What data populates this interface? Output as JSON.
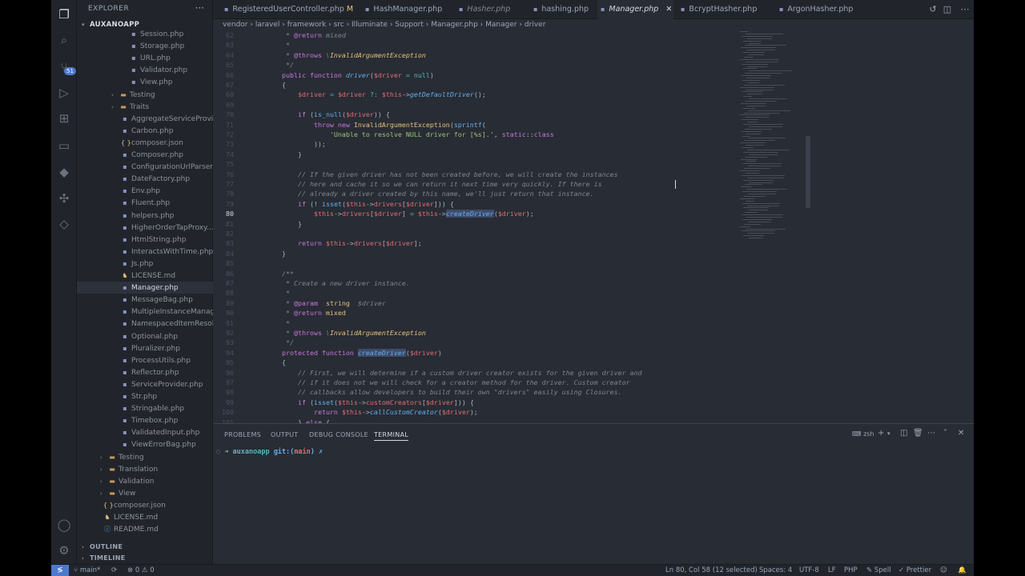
{
  "sidebar": {
    "title": "EXPLORER",
    "more": "···",
    "project": "AUXANOAPP",
    "items": [
      {
        "label": "Session.php",
        "icon": "php",
        "indent": 2
      },
      {
        "label": "Storage.php",
        "icon": "php",
        "indent": 2
      },
      {
        "label": "URL.php",
        "icon": "php",
        "indent": 2
      },
      {
        "label": "Validator.php",
        "icon": "php",
        "indent": 2
      },
      {
        "label": "View.php",
        "icon": "php",
        "indent": 2
      },
      {
        "label": "Testing",
        "icon": "folder",
        "indent": 1
      },
      {
        "label": "Traits",
        "icon": "folder",
        "indent": 1
      },
      {
        "label": "AggregateServiceProvi...",
        "icon": "php",
        "indent": 1
      },
      {
        "label": "Carbon.php",
        "icon": "php",
        "indent": 1
      },
      {
        "label": "composer.json",
        "icon": "json",
        "indent": 1
      },
      {
        "label": "Composer.php",
        "icon": "php",
        "indent": 1
      },
      {
        "label": "ConfigurationUrlParser...",
        "icon": "php",
        "indent": 1
      },
      {
        "label": "DateFactory.php",
        "icon": "php",
        "indent": 1
      },
      {
        "label": "Env.php",
        "icon": "php",
        "indent": 1
      },
      {
        "label": "Fluent.php",
        "icon": "php",
        "indent": 1
      },
      {
        "label": "helpers.php",
        "icon": "php",
        "indent": 1
      },
      {
        "label": "HigherOrderTapProxy....",
        "icon": "php",
        "indent": 1
      },
      {
        "label": "HtmlString.php",
        "icon": "php",
        "indent": 1
      },
      {
        "label": "InteractsWithTime.php",
        "icon": "php",
        "indent": 1
      },
      {
        "label": "Js.php",
        "icon": "php",
        "indent": 1
      },
      {
        "label": "LICENSE.md",
        "icon": "lic",
        "indent": 1
      },
      {
        "label": "Manager.php",
        "icon": "php",
        "indent": 1,
        "selected": true
      },
      {
        "label": "MessageBag.php",
        "icon": "php",
        "indent": 1
      },
      {
        "label": "MultipleInstanceManag...",
        "icon": "php",
        "indent": 1
      },
      {
        "label": "NamespacedItemResol...",
        "icon": "php",
        "indent": 1
      },
      {
        "label": "Optional.php",
        "icon": "php",
        "indent": 1
      },
      {
        "label": "Pluralizer.php",
        "icon": "php",
        "indent": 1
      },
      {
        "label": "ProcessUtils.php",
        "icon": "php",
        "indent": 1
      },
      {
        "label": "Reflector.php",
        "icon": "php",
        "indent": 1
      },
      {
        "label": "ServiceProvider.php",
        "icon": "php",
        "indent": 1
      },
      {
        "label": "Str.php",
        "icon": "php",
        "indent": 1
      },
      {
        "label": "Stringable.php",
        "icon": "php",
        "indent": 1
      },
      {
        "label": "Timebox.php",
        "icon": "php",
        "indent": 1
      },
      {
        "label": "ValidatedInput.php",
        "icon": "php",
        "indent": 1
      },
      {
        "label": "ViewErrorBag.php",
        "icon": "php",
        "indent": 1
      },
      {
        "label": "Testing",
        "icon": "folder",
        "indent": 0
      },
      {
        "label": "Translation",
        "icon": "folder",
        "indent": 0
      },
      {
        "label": "Validation",
        "icon": "folder",
        "indent": 0
      },
      {
        "label": "View",
        "icon": "folder",
        "indent": 0
      },
      {
        "label": "composer.json",
        "icon": "json",
        "indent": -1
      },
      {
        "label": "LICENSE.md",
        "icon": "lic",
        "indent": -1
      },
      {
        "label": "README.md",
        "icon": "md",
        "indent": -1
      }
    ],
    "outline": "OUTLINE",
    "timeline": "TIMELINE"
  },
  "activity": {
    "scm_badge": "51"
  },
  "tabs": [
    {
      "label": "RegisteredUserController.php",
      "suffix": "M",
      "italic": false
    },
    {
      "label": "HashManager.php",
      "italic": false
    },
    {
      "label": "Hasher.php",
      "italic": true
    },
    {
      "label": "hashing.php",
      "italic": false
    },
    {
      "label": "Manager.php",
      "italic": true,
      "active": true,
      "close": "✕"
    },
    {
      "label": "BcryptHasher.php",
      "italic": false
    },
    {
      "label": "ArgonHasher.php",
      "italic": false
    }
  ],
  "breadcrumb": [
    "vendor",
    "laravel",
    "framework",
    "src",
    "Illuminate",
    "Support",
    "Manager.php",
    "Manager",
    "driver"
  ],
  "editor": {
    "current_line": "80",
    "line_numbers": [
      "62",
      "63",
      "64",
      "65",
      "66",
      "67",
      "68",
      "69",
      "70",
      "71",
      "72",
      "73",
      "74",
      "75",
      "76",
      "77",
      "78",
      "79",
      "80",
      "81",
      "82",
      "83",
      "84",
      "85",
      "86",
      "87",
      "88",
      "89",
      "90",
      "91",
      "92",
      "93",
      "94",
      "95",
      "96",
      "97",
      "98",
      "99",
      "100",
      "101"
    ]
  },
  "panel": {
    "tabs": [
      "PROBLEMS",
      "OUTPUT",
      "DEBUG CONSOLE",
      "TERMINAL"
    ],
    "active_tab": "TERMINAL",
    "shell": "zsh",
    "prompt_dir": "auxanoapp",
    "prompt_git": "git:(",
    "prompt_branch": "main",
    "prompt_end": ") ✗"
  },
  "status": {
    "branch": "main*",
    "sync": "⟳",
    "problems": "⊗ 0 ⚠ 0",
    "position": "Ln 80, Col 58 (12 selected)",
    "spaces": "Spaces: 4",
    "encoding": "UTF-8",
    "eol": "LF",
    "language": "PHP",
    "spell": "Spell",
    "prettier": "✓ Prettier"
  },
  "colors": {
    "accent": "#4d78cc",
    "background": "#282c34",
    "sidebar": "#21252b"
  }
}
